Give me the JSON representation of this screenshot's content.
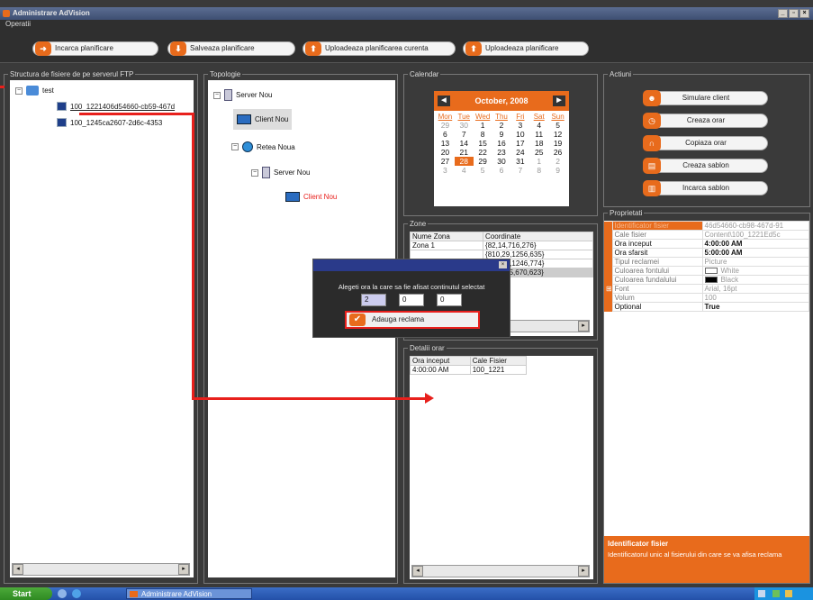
{
  "window": {
    "title": "Administrare AdVision"
  },
  "operatii": {
    "label": "Operatii",
    "buttons": [
      {
        "label": "Incarca planificare",
        "icon": "arrow-right-icon"
      },
      {
        "label": "Salveaza planificare",
        "icon": "arrow-down-icon"
      },
      {
        "label": "Uploadeaza planificarea curenta",
        "icon": "upload-icon"
      },
      {
        "label": "Uploadeaza planificare",
        "icon": "upload-icon"
      }
    ]
  },
  "ftp": {
    "label": "Structura de fisiere de pe serverul FTP",
    "root": "test",
    "files": [
      "100_1221406d54660-cb59-467d",
      "100_1245ca2607-2d6c-4353"
    ]
  },
  "topologie": {
    "label": "Topologie",
    "nodes": [
      "Server Nou",
      "Client Nou",
      "Retea Noua",
      "Server Nou",
      "Client Nou"
    ]
  },
  "calendar": {
    "label": "Calendar",
    "month": "October, 2008",
    "day_names": [
      "Mon",
      "Tue",
      "Wed",
      "Thu",
      "Fri",
      "Sat",
      "Sun"
    ],
    "weeks": [
      [
        "29",
        "30",
        "1",
        "2",
        "3",
        "4",
        "5"
      ],
      [
        "6",
        "7",
        "8",
        "9",
        "10",
        "11",
        "12"
      ],
      [
        "13",
        "14",
        "15",
        "16",
        "17",
        "18",
        "19"
      ],
      [
        "20",
        "21",
        "22",
        "23",
        "24",
        "25",
        "26"
      ],
      [
        "27",
        "28",
        "29",
        "30",
        "31",
        "1",
        "2"
      ],
      [
        "3",
        "4",
        "5",
        "6",
        "7",
        "8",
        "9"
      ]
    ],
    "selected_day": "28"
  },
  "zone": {
    "label": "Zone",
    "headers": [
      "Nume Zona",
      "Coordinate"
    ],
    "rows": [
      [
        "Zona 1",
        "{82,14,716,276}"
      ],
      [
        "",
        "{810,29,1256,635}"
      ],
      [
        "",
        "{81,636,1246,774}"
      ],
      [
        "",
        "{114,315,670,623}"
      ]
    ]
  },
  "detalii": {
    "label": "Detalii orar",
    "headers": [
      "Ora inceput",
      "Cale Fisier"
    ],
    "rows": [
      [
        "4:00:00 AM",
        "100_1221"
      ]
    ]
  },
  "actiuni": {
    "label": "Actiuni",
    "buttons": [
      "Simulare client",
      "Creaza orar",
      "Copiaza orar",
      "Creaza sablon",
      "Incarca sablon"
    ]
  },
  "proprietati": {
    "label": "Proprietati",
    "rows": [
      {
        "key": "Identificator fisier",
        "value": "46d54660-cb98-467d-91"
      },
      {
        "key": "Cale fisier",
        "value": "Content\\100_1221Ed5c"
      },
      {
        "key": "Ora inceput",
        "value": "4:00:00 AM"
      },
      {
        "key": "Ora sfarsit",
        "value": "5:00:00 AM"
      },
      {
        "key": "Tipul reclamei",
        "value": "Picture"
      },
      {
        "key": "Culoarea fontului",
        "value": "White"
      },
      {
        "key": "Culoarea fundalului",
        "value": "Black"
      },
      {
        "key": "Font",
        "value": "Arial, 16pt"
      },
      {
        "key": "Volum",
        "value": "100"
      },
      {
        "key": "Optional",
        "value": "True"
      }
    ],
    "description_title": "Identificator fisier",
    "description_text": "Identificatorul unic al fisierului din care se va afisa reclama"
  },
  "dialog": {
    "message": "Alegeti ora la care sa fie afisat continutul selectat",
    "values": [
      "2",
      "0",
      "0"
    ],
    "ok_label": "Adauga reclama"
  },
  "taskbar": {
    "start": "Start",
    "item": "Administrare AdVision"
  },
  "colors": {
    "accent": "#e86b1c",
    "highlight": "#e8201c"
  }
}
